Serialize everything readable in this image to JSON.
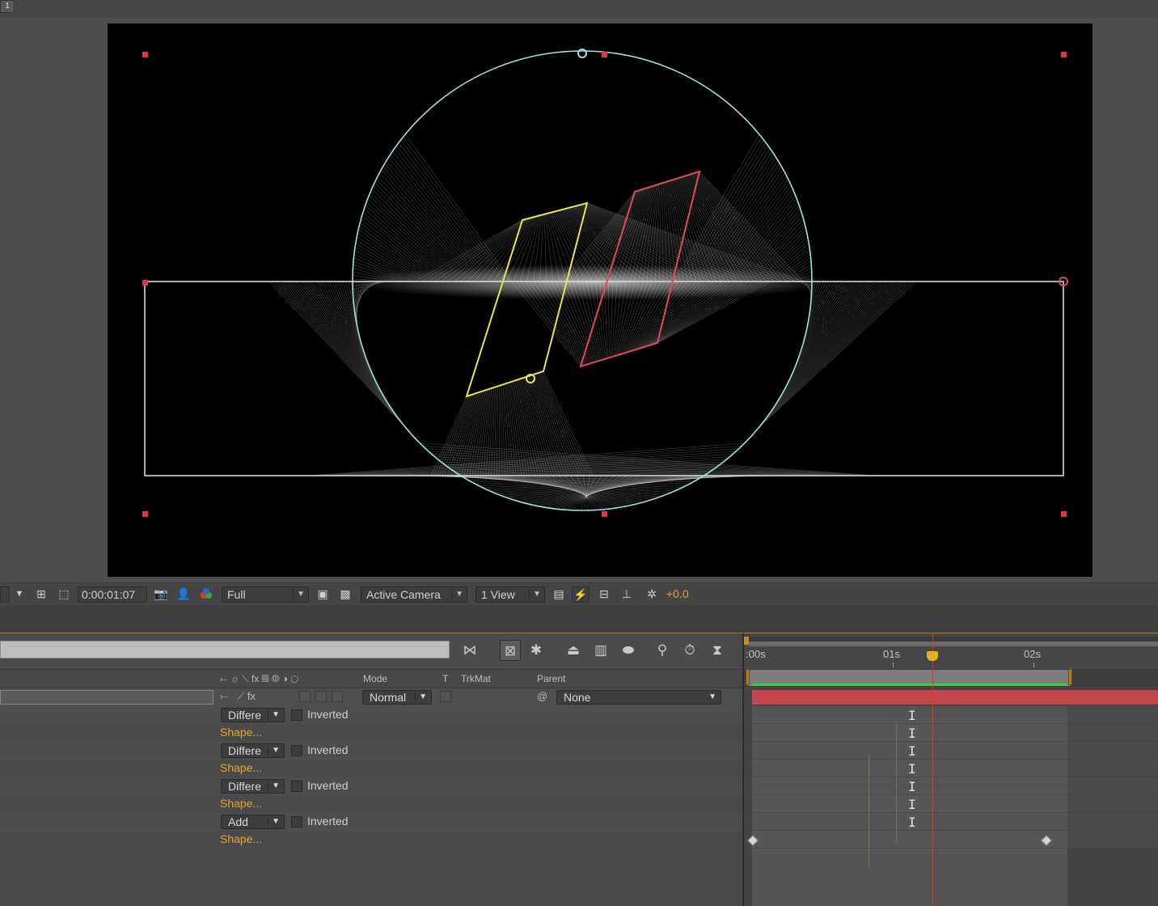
{
  "window": {
    "tab_number": "1"
  },
  "viewer_toolbar": {
    "timecode": "0:00:01:07",
    "resolution": "Full",
    "camera": "Active Camera",
    "views": "1 View",
    "exposure": "+0.0"
  },
  "timeline": {
    "columns": {
      "mode": "Mode",
      "t": "T",
      "trkmat": "TrkMat",
      "parent": "Parent"
    },
    "layer": {
      "mode": "Normal",
      "parent": "None"
    },
    "masks": [
      {
        "mode": "Differe",
        "inverted_label": "Inverted",
        "shape_label": "Shape..."
      },
      {
        "mode": "Differe",
        "inverted_label": "Inverted",
        "shape_label": "Shape..."
      },
      {
        "mode": "Differe",
        "inverted_label": "Inverted",
        "shape_label": "Shape..."
      },
      {
        "mode": "Add",
        "inverted_label": "Inverted",
        "shape_label": "Shape..."
      }
    ],
    "ruler": {
      "ticks": [
        ":00s",
        "01s",
        "02s"
      ]
    }
  },
  "colors": {
    "accent_orange": "#e0a531",
    "playhead": "#e0302f",
    "layer_bar": "#c4474b",
    "work_area_green": "#2fd13d",
    "mask_yellow": "#e6e84a",
    "mask_red": "#e04a5c",
    "mask_cyan": "#9fe3df"
  }
}
